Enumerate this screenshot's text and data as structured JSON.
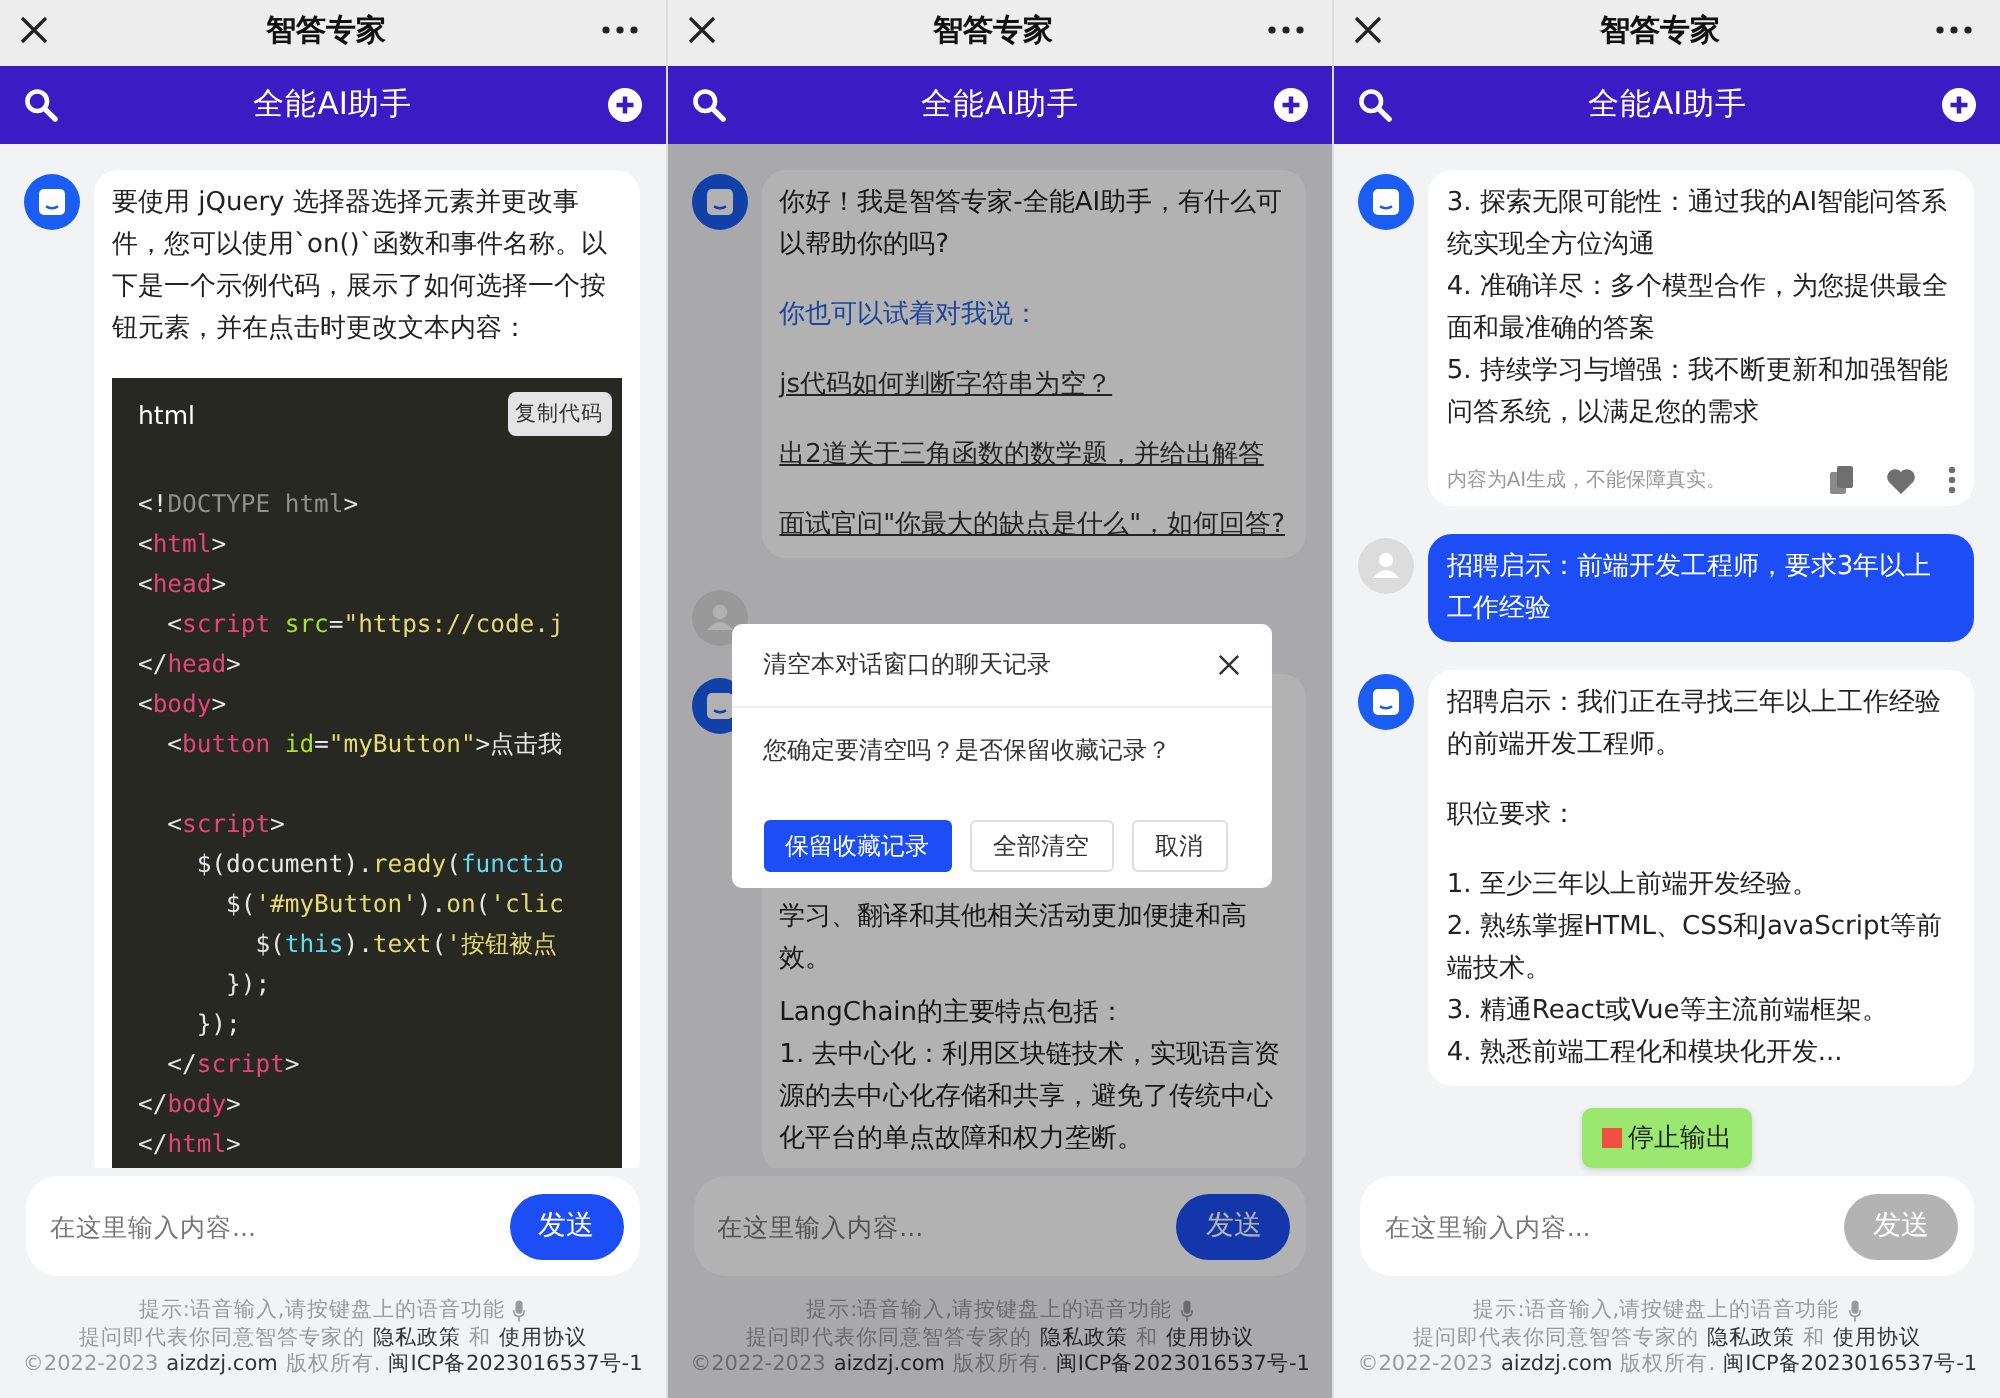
{
  "panels": [
    {
      "top_bar": {
        "title": "智答专家"
      },
      "header": {
        "title": "全能AI助手"
      },
      "dimmed": false,
      "messages": [
        {
          "kind": "ai",
          "hidden_top": false,
          "blocks": [
            {
              "kind": "text",
              "text": "要使用 jQuery 选择器选择元素并更改事件，您可以使用`on()`函数和事件名称。以下是一个示例代码，展示了如何选择一个按钮元素，并在点击时更改文本内容："
            },
            {
              "kind": "code",
              "language": "html",
              "copy_label": "复制代码",
              "lines": [
                {
                  "kind": "code",
                  "tokens": [
                    {
                      "kind": "plain",
                      "text": "<!"
                    },
                    {
                      "kind": "doctype",
                      "text": "DOCTYPE html"
                    },
                    {
                      "kind": "plain",
                      "text": ">"
                    }
                  ]
                },
                {
                  "kind": "code",
                  "tokens": [
                    {
                      "kind": "plain",
                      "text": "<"
                    },
                    {
                      "kind": "tag",
                      "text": "html"
                    },
                    {
                      "kind": "plain",
                      "text": ">"
                    }
                  ]
                },
                {
                  "kind": "code",
                  "tokens": [
                    {
                      "kind": "plain",
                      "text": "<"
                    },
                    {
                      "kind": "tag",
                      "text": "head"
                    },
                    {
                      "kind": "plain",
                      "text": ">"
                    }
                  ]
                },
                {
                  "kind": "code",
                  "tokens": [
                    {
                      "kind": "plain",
                      "text": "  <"
                    },
                    {
                      "kind": "tag",
                      "text": "script"
                    },
                    {
                      "kind": "attr",
                      "text": " src"
                    },
                    {
                      "kind": "plain",
                      "text": "="
                    },
                    {
                      "kind": "string",
                      "text": "\"https://code.j"
                    }
                  ]
                },
                {
                  "kind": "code",
                  "tokens": [
                    {
                      "kind": "plain",
                      "text": "</"
                    },
                    {
                      "kind": "tag",
                      "text": "head"
                    },
                    {
                      "kind": "plain",
                      "text": ">"
                    }
                  ]
                },
                {
                  "kind": "code",
                  "tokens": [
                    {
                      "kind": "plain",
                      "text": "<"
                    },
                    {
                      "kind": "tag",
                      "text": "body"
                    },
                    {
                      "kind": "plain",
                      "text": ">"
                    }
                  ]
                },
                {
                  "kind": "code",
                  "tokens": [
                    {
                      "kind": "plain",
                      "text": "  <"
                    },
                    {
                      "kind": "tag",
                      "text": "button"
                    },
                    {
                      "kind": "attr",
                      "text": " id"
                    },
                    {
                      "kind": "plain",
                      "text": "="
                    },
                    {
                      "kind": "string",
                      "text": "\"myButton\""
                    },
                    {
                      "kind": "plain",
                      "text": ">点击我"
                    }
                  ]
                },
                {
                  "kind": "blank"
                },
                {
                  "kind": "code",
                  "tokens": [
                    {
                      "kind": "plain",
                      "text": "  <"
                    },
                    {
                      "kind": "tag",
                      "text": "script"
                    },
                    {
                      "kind": "plain",
                      "text": ">"
                    }
                  ]
                },
                {
                  "kind": "code",
                  "tokens": [
                    {
                      "kind": "plain",
                      "text": "    $(document)."
                    },
                    {
                      "kind": "method",
                      "text": "ready"
                    },
                    {
                      "kind": "plain",
                      "text": "("
                    },
                    {
                      "kind": "keyword",
                      "text": "functio"
                    }
                  ]
                },
                {
                  "kind": "code",
                  "tokens": [
                    {
                      "kind": "plain",
                      "text": "      $("
                    },
                    {
                      "kind": "string",
                      "text": "'#myButton'"
                    },
                    {
                      "kind": "plain",
                      "text": ")."
                    },
                    {
                      "kind": "method",
                      "text": "on"
                    },
                    {
                      "kind": "plain",
                      "text": "("
                    },
                    {
                      "kind": "string",
                      "text": "'clic"
                    }
                  ]
                },
                {
                  "kind": "code",
                  "tokens": [
                    {
                      "kind": "plain",
                      "text": "        $("
                    },
                    {
                      "kind": "keyword",
                      "text": "this"
                    },
                    {
                      "kind": "plain",
                      "text": ")."
                    },
                    {
                      "kind": "method",
                      "text": "text"
                    },
                    {
                      "kind": "plain",
                      "text": "("
                    },
                    {
                      "kind": "string",
                      "text": "'按钮被点"
                    }
                  ]
                },
                {
                  "kind": "code",
                  "tokens": [
                    {
                      "kind": "plain",
                      "text": "      });"
                    }
                  ]
                },
                {
                  "kind": "code",
                  "tokens": [
                    {
                      "kind": "plain",
                      "text": "    });"
                    }
                  ]
                },
                {
                  "kind": "code",
                  "tokens": [
                    {
                      "kind": "plain",
                      "text": "  </"
                    },
                    {
                      "kind": "tag",
                      "text": "script"
                    },
                    {
                      "kind": "plain",
                      "text": ">"
                    }
                  ]
                },
                {
                  "kind": "code",
                  "tokens": [
                    {
                      "kind": "plain",
                      "text": "</"
                    },
                    {
                      "kind": "tag",
                      "text": "body"
                    },
                    {
                      "kind": "plain",
                      "text": ">"
                    }
                  ]
                },
                {
                  "kind": "code",
                  "tokens": [
                    {
                      "kind": "plain",
                      "text": "</"
                    },
                    {
                      "kind": "tag",
                      "text": "html"
                    },
                    {
                      "kind": "plain",
                      "text": ">"
                    }
                  ]
                }
              ]
            }
          ]
        }
      ],
      "input": {
        "placeholder": "在这里输入内容...",
        "send_label": "发送",
        "send_disabled": false
      },
      "footer": {
        "hint": "提示:语音输入,请按键盘上的语音功能",
        "lines": [
          [
            {
              "kind": "plain",
              "text": "提问即代表你同意智答专家的"
            },
            {
              "kind": "link",
              "text": "隐私政策"
            },
            {
              "kind": "plain",
              "text": "和"
            },
            {
              "kind": "link",
              "text": "使用协议"
            }
          ],
          [
            {
              "kind": "plain",
              "text": "©2022-2023"
            },
            {
              "kind": "link",
              "text": "aizdzj.com"
            },
            {
              "kind": "plain",
              "text": "版权所有."
            },
            {
              "kind": "link",
              "text": "闽ICP备2023016537号-1"
            }
          ]
        ]
      }
    },
    {
      "top_bar": {
        "title": "智答专家"
      },
      "header": {
        "title": "全能AI助手"
      },
      "dimmed": true,
      "messages": [
        {
          "kind": "ai",
          "hidden_top": false,
          "blocks": [
            {
              "kind": "text",
              "text": "你好！我是智答专家-全能AI助手，有什么可以帮助你的吗?"
            },
            {
              "kind": "prompt",
              "text": "你也可以试着对我说："
            },
            {
              "kind": "link",
              "text": "js代码如何判断字符串为空？"
            },
            {
              "kind": "link",
              "text": "出2道关于三角函数的数学题，并给出解答"
            },
            {
              "kind": "link",
              "text": "面试官问\"你最大的缺点是什么\"，如何回答?"
            }
          ]
        },
        {
          "kind": "user"
        },
        {
          "kind": "ai",
          "hidden_top": true,
          "blocks": [
            {
              "kind": "text",
              "text": "学习、翻译和其他相关活动更加便捷和高效。"
            },
            {
              "kind": "list",
              "items": [
                "LangChain的主要特点包括：",
                "1. 去中心化：利用区块链技术，实现语言资源的去中心化存储和共享，避免了传统中心化平台的单点故障和权力垄断。"
              ]
            }
          ]
        }
      ],
      "dialog": {
        "title": "清空本对话窗口的聊天记录",
        "message": "您确定要清空吗？是否保留收藏记录？",
        "buttons": [
          {
            "kind": "primary",
            "label": "保留收藏记录"
          },
          {
            "kind": "secondary",
            "label": "全部清空"
          },
          {
            "kind": "secondary",
            "label": "取消"
          }
        ]
      },
      "input": {
        "placeholder": "在这里输入内容...",
        "send_label": "发送",
        "send_disabled": false
      },
      "footer": {
        "hint": "提示:语音输入,请按键盘上的语音功能",
        "lines": [
          [
            {
              "kind": "plain",
              "text": "提问即代表你同意智答专家的"
            },
            {
              "kind": "link",
              "text": "隐私政策"
            },
            {
              "kind": "plain",
              "text": "和"
            },
            {
              "kind": "link",
              "text": "使用协议"
            }
          ],
          [
            {
              "kind": "plain",
              "text": "©2022-2023"
            },
            {
              "kind": "link",
              "text": "aizdzj.com"
            },
            {
              "kind": "plain",
              "text": "版权所有."
            },
            {
              "kind": "link",
              "text": "闽ICP备2023016537号-1"
            }
          ]
        ]
      }
    },
    {
      "top_bar": {
        "title": "智答专家"
      },
      "header": {
        "title": "全能AI助手"
      },
      "dimmed": false,
      "messages": [
        {
          "kind": "ai",
          "hidden_top": false,
          "blocks": [
            {
              "kind": "list",
              "items": [
                "3. 探索无限可能性：通过我的AI智能问答系统实现全方位沟通",
                "4. 准确详尽：多个模型合作，为您提供最全面和最准确的答案",
                "5. 持续学习与增强：我不断更新和加强智能问答系统，以满足您的需求"
              ]
            },
            {
              "kind": "note",
              "text": "内容为AI生成，不能保障真实。"
            }
          ]
        },
        {
          "kind": "user",
          "text": "招聘启示：前端开发工程师，要求3年以上工作经验"
        },
        {
          "kind": "ai",
          "hidden_top": false,
          "blocks": [
            {
              "kind": "text",
              "text": "招聘启示：我们正在寻找三年以上工作经验的前端开发工程师。"
            },
            {
              "kind": "text",
              "text": "职位要求："
            },
            {
              "kind": "list",
              "items": [
                "1. 至少三年以上前端开发经验。",
                "2. 熟练掌握HTML、CSS和JavaScript等前端技术。",
                "3. 精通React或Vue等主流前端框架。",
                "4. 熟悉前端工程化和模块化开发..."
              ]
            }
          ]
        }
      ],
      "stop_button": {
        "label": "停止输出"
      },
      "input": {
        "placeholder": "在这里输入内容...",
        "send_label": "发送",
        "send_disabled": true
      },
      "footer": {
        "hint": "提示:语音输入,请按键盘上的语音功能",
        "lines": [
          [
            {
              "kind": "plain",
              "text": "提问即代表你同意智答专家的"
            },
            {
              "kind": "link",
              "text": "隐私政策"
            },
            {
              "kind": "plain",
              "text": "和"
            },
            {
              "kind": "link",
              "text": "使用协议"
            }
          ],
          [
            {
              "kind": "plain",
              "text": "©2022-2023"
            },
            {
              "kind": "link",
              "text": "aizdzj.com"
            },
            {
              "kind": "plain",
              "text": "版权所有."
            },
            {
              "kind": "link",
              "text": "闽ICP备2023016537号-1"
            }
          ]
        ]
      }
    }
  ]
}
